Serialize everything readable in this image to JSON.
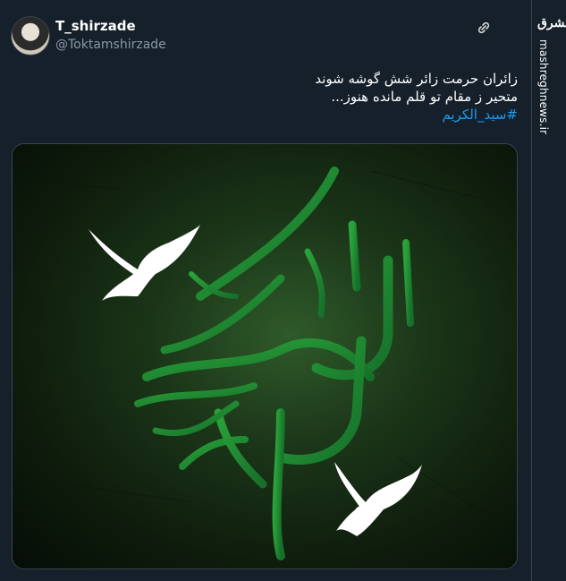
{
  "tweet": {
    "display_name": "T_shirzade",
    "handle": "@Toktamshirzade",
    "lines": [
      "زائران حرمت زائر شش گوشه شوند",
      "متحیر ز مقام تو قلم مانده هنوز..."
    ],
    "hashtag": "#سید_الکریم"
  },
  "site": {
    "logo_text": "مشرق",
    "url": "mashreghnews.ir"
  },
  "media": {
    "calligraphy_text": "السلام علیک یا سید الکریم",
    "dove_color": "#ffffff",
    "calligraphy_color": "#1f8a2c"
  }
}
